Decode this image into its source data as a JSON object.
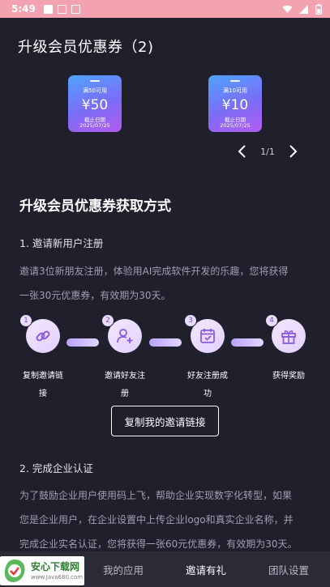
{
  "status_bar": {
    "time": "5:49"
  },
  "coupons_section": {
    "title": "升级会员优惠券（2)",
    "coupons": [
      {
        "condition": "满50可用",
        "amount": "¥50",
        "expiry_label": "截止日期",
        "expiry_date": "2025/07/25"
      },
      {
        "condition": "满10可用",
        "amount": "¥10",
        "expiry_label": "截止日期",
        "expiry_date": "2025/07/25"
      }
    ],
    "pager": {
      "text": "1/1"
    }
  },
  "ways_section": {
    "title": "升级会员优惠券获取方式",
    "way1": {
      "heading": "1. 邀请新用户注册",
      "description_line1": "邀请3位新朋友注册，体验用AI完成软件开发的乐趣，您将获得",
      "description_line2": "一张30元优惠券，有效期为30天。"
    },
    "steps": [
      {
        "number": "1",
        "icon": "link-icon",
        "label_line1": "复制邀请链",
        "label_line2": "接"
      },
      {
        "number": "2",
        "icon": "add-user-icon",
        "label_line1": "邀请好友注",
        "label_line2": "册"
      },
      {
        "number": "3",
        "icon": "calendar-check-icon",
        "label_line1": "好友注册成",
        "label_line2": "功"
      },
      {
        "number": "4",
        "icon": "gift-icon",
        "label_line1": "获得奖励",
        "label_line2": ""
      }
    ],
    "invite_button": "复制我的邀请链接",
    "way2": {
      "heading": "2. 完成企业认证",
      "description_line1": "为了鼓励企业用户使用码上飞，帮助企业实现数字化转型，如果",
      "description_line2": "您是企业用户，在企业设置中上传企业logo和真实企业名称，并",
      "description_line3": "完成企业实名认证，您将获得一张60元优惠券，有效期为30天。"
    }
  },
  "bottom_nav": {
    "items": [
      {
        "label": "我的应用",
        "active": false
      },
      {
        "label": "邀请有礼",
        "active": true
      },
      {
        "label": "团队设置",
        "active": false
      }
    ]
  },
  "watermark": {
    "title": "安心下载网",
    "url": "www.Java680.com"
  },
  "colors": {
    "background": "#201f2c",
    "status_bar": "#f3a3b0",
    "accent_purple": "#b35cf0",
    "accent_blue": "#4fa3ff",
    "bottom_nav": "#2b2a37"
  }
}
